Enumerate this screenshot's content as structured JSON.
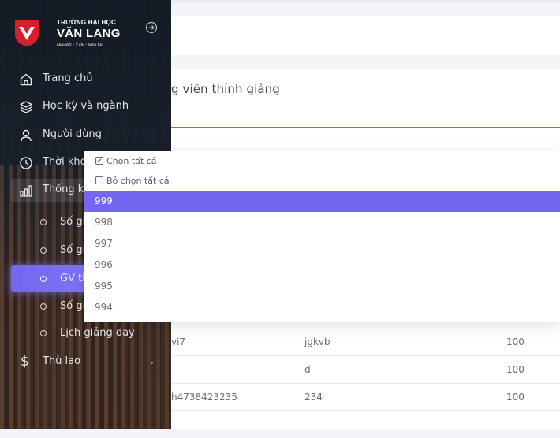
{
  "brand": {
    "line1": "TRƯỜNG ĐẠI HỌC",
    "line2": "VĂN LANG",
    "slogan": "Đạo đức - Ý chí - Sáng tạo",
    "color": "#d71e2b"
  },
  "page": {
    "title": "g viên thỉnh giảng"
  },
  "sidebar": {
    "items": [
      {
        "label": "Trang chủ",
        "icon": "home-icon"
      },
      {
        "label": "Học kỳ và ngành",
        "icon": "layers-icon"
      },
      {
        "label": "Người dùng",
        "icon": "user-icon"
      },
      {
        "label": "Thời kho",
        "icon": "clock-icon"
      },
      {
        "label": "Thống k",
        "icon": "bar-chart-icon"
      }
    ],
    "subitems": [
      {
        "label": "Số gi"
      },
      {
        "label": "Số gi"
      },
      {
        "label": "GV th"
      },
      {
        "label": "Số gi"
      },
      {
        "label": "Lịch giảng dạy"
      }
    ],
    "payment": {
      "label": "Thù lao",
      "icon": "dollar-icon",
      "chevron": "›"
    }
  },
  "dropdown": {
    "select_all": "Chọn tất cả",
    "deselect_all": "Bỏ chọn tất cả",
    "options": [
      "999",
      "998",
      "997",
      "996",
      "995",
      "994"
    ],
    "selected": "999"
  },
  "table": {
    "rows": [
      [
        "vi7",
        "jgkvb",
        "100"
      ],
      [
        "",
        "d",
        "100"
      ],
      [
        "h4738423235",
        "234",
        "100"
      ]
    ]
  },
  "colors": {
    "accent": "#7367f0",
    "sidebar_bg": "#121b26"
  }
}
